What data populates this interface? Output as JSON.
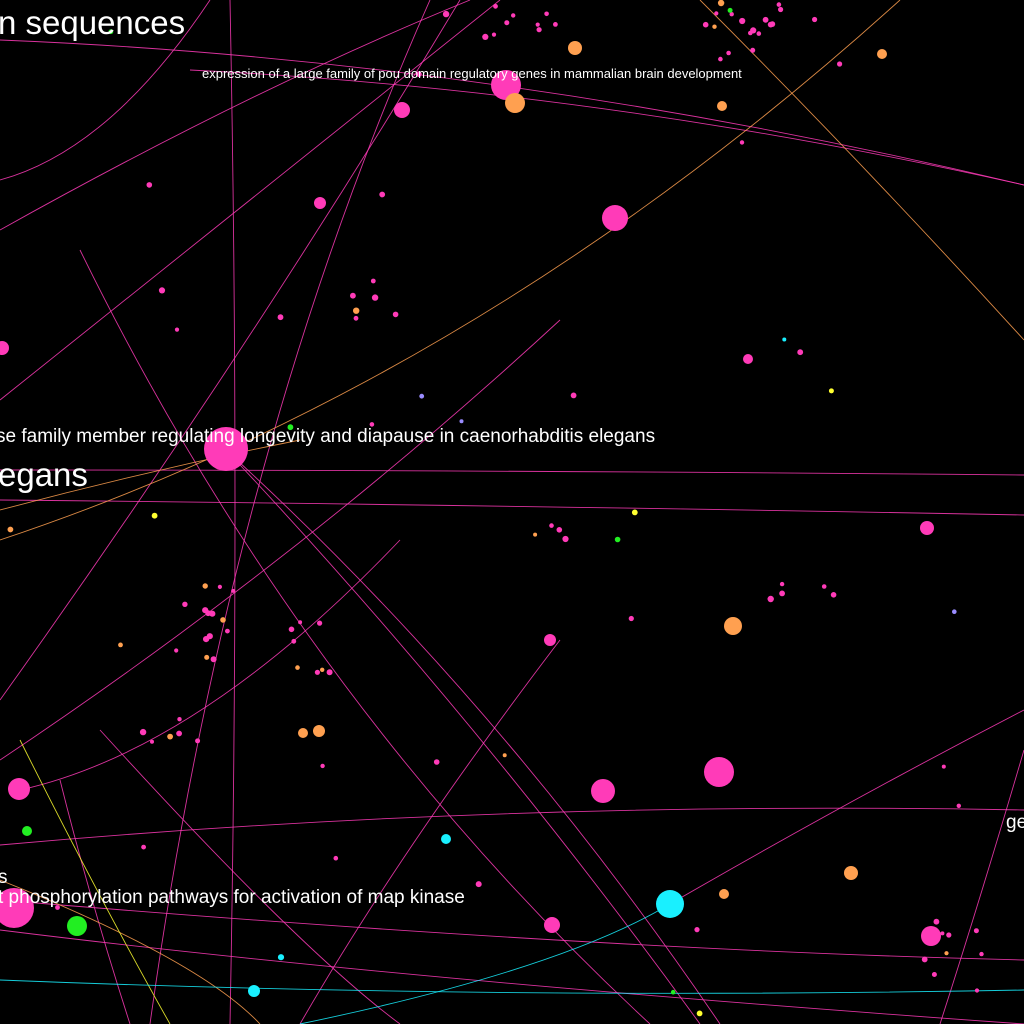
{
  "colors": {
    "background": "#000000",
    "magenta": "#ff3bb8",
    "orange": "#ffa050",
    "cyan": "#19f0ff",
    "green": "#22ee22",
    "yellow": "#ffff30",
    "lavender": "#9a8cff"
  },
  "labels": {
    "top_left": "n sequences",
    "pou_domain": "expression of a large family of pou domain regulatory genes in mammalian brain development",
    "longevity": "se family member regulating longevity and diapause in caenorhabditis elegans",
    "elegans": "egans",
    "right_edge": "ge",
    "s_fragment": "s",
    "map_kinase": "t phosphorylation pathways for activation of map kinase"
  }
}
